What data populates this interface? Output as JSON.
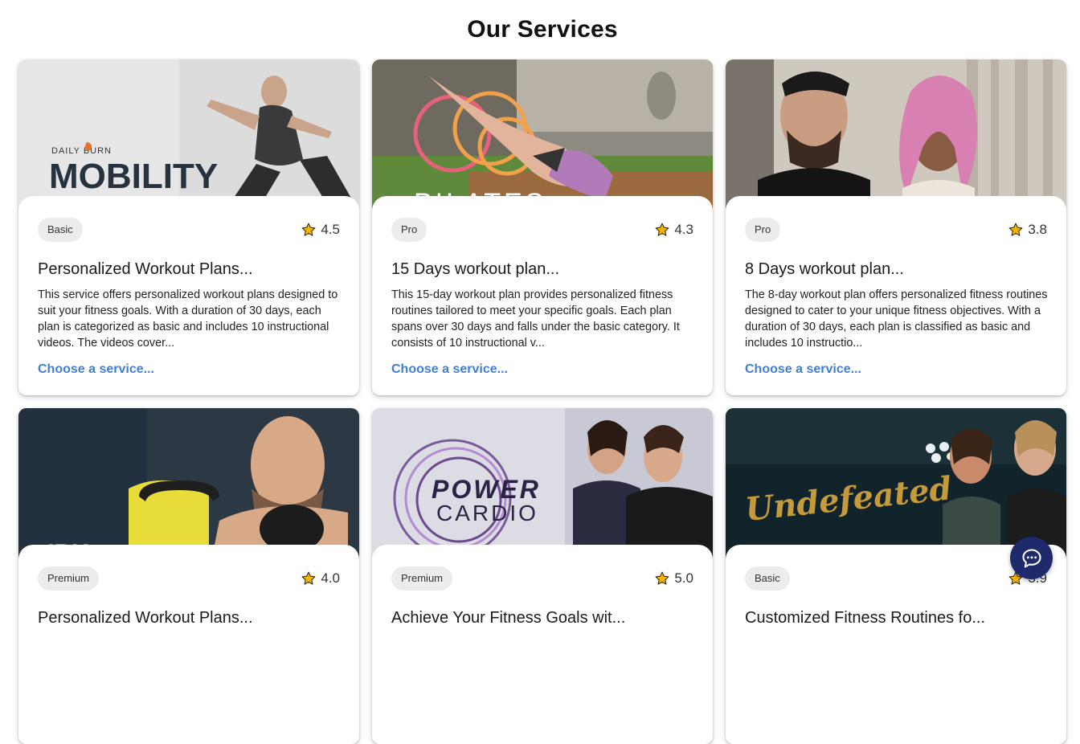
{
  "page": {
    "title": "Our Services"
  },
  "cards": [
    {
      "image_text": "MOBILITY",
      "image_brand": "DAILY BURN",
      "badge": "Basic",
      "rating": "4.5",
      "title": "Personalized Workout Plans...",
      "description": "This service offers personalized workout plans designed to suit your fitness goals. With a duration of 30 days, each plan is categorized as basic and includes 10 instructional videos. The videos cover...",
      "link": "Choose a service..."
    },
    {
      "image_text": "PILATES",
      "badge": "Pro",
      "rating": "4.3",
      "title": "15 Days workout plan...",
      "description": "This 15-day workout plan provides personalized fitness routines tailored to meet your specific goals. Each plan spans over 30 days and falls under the basic category. It consists of 10 instructional v...",
      "link": "Choose a service..."
    },
    {
      "badge": "Pro",
      "rating": "3.8",
      "title": "8 Days workout plan...",
      "description": "The 8-day workout plan offers personalized fitness routines designed to cater to your unique fitness objectives. With a duration of 30 days, each plan is classified as basic and includes 10 instructio...",
      "link": "Choose a service..."
    },
    {
      "badge": "Premium",
      "rating": "4.0",
      "title": "Personalized Workout Plans...",
      "description": "",
      "link": ""
    },
    {
      "image_text_1": "POWER",
      "image_text_2": "CARDIO",
      "badge": "Premium",
      "rating": "5.0",
      "title": "Achieve Your Fitness Goals wit...",
      "description": "",
      "link": ""
    },
    {
      "image_text": "Undefeated",
      "badge": "Basic",
      "rating": "3.9",
      "title": "Customized Fitness Routines fo...",
      "description": "",
      "link": ""
    }
  ],
  "colors": {
    "link": "#3d7fd4",
    "badge_bg": "#ececec",
    "chat_button": "#1e2a6b",
    "star": "#f5b301"
  },
  "icons": {
    "rating": "star-icon",
    "chat": "chat-bubble-icon"
  }
}
